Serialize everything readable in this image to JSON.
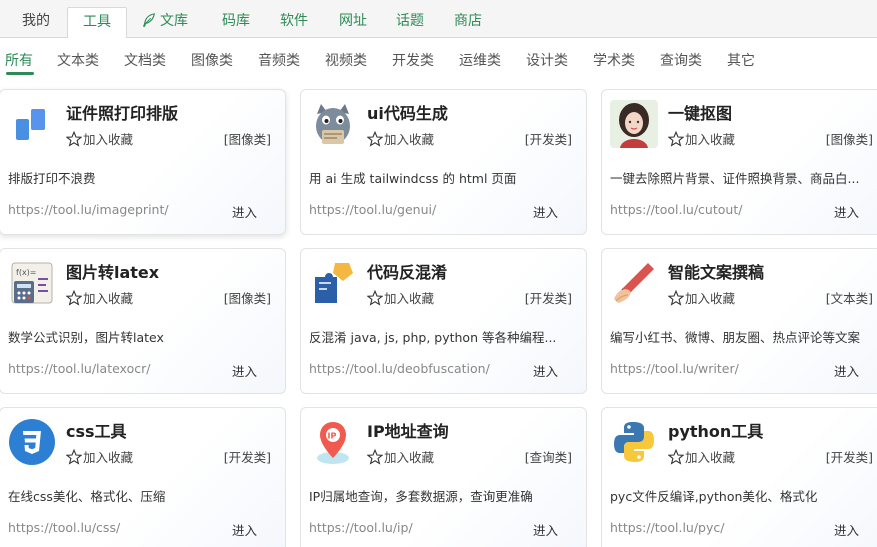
{
  "top_nav": [
    "我的",
    "工具",
    "文库",
    "码库",
    "软件",
    "网址",
    "话题",
    "商店"
  ],
  "categories": [
    "所有",
    "文本类",
    "文档类",
    "图像类",
    "音频类",
    "视频类",
    "开发类",
    "运维类",
    "设计类",
    "学术类",
    "查询类",
    "其它"
  ],
  "fav_label": "加入收藏",
  "enter_label": "进入",
  "tools": [
    {
      "title": "证件照打印排版",
      "tag": "[图像类]",
      "desc": "排版打印不浪费",
      "url": "https://tool.lu/imageprint/"
    },
    {
      "title": "ui代码生成",
      "tag": "[开发类]",
      "desc": "用 ai 生成 tailwindcss 的 html 页面",
      "url": "https://tool.lu/genui/"
    },
    {
      "title": "一键抠图",
      "tag": "[图像类]",
      "desc": "一键去除照片背景、证件照换背景、商品白...",
      "url": "https://tool.lu/cutout/"
    },
    {
      "title": "图片转latex",
      "tag": "[图像类]",
      "desc": "数学公式识别，图片转latex",
      "url": "https://tool.lu/latexocr/"
    },
    {
      "title": "代码反混淆",
      "tag": "[开发类]",
      "desc": "反混淆 java, js, php, python 等各种编程...",
      "url": "https://tool.lu/deobfuscation/"
    },
    {
      "title": "智能文案撰稿",
      "tag": "[文本类]",
      "desc": "编写小红书、微博、朋友圈、热点评论等文案",
      "url": "https://tool.lu/writer/"
    },
    {
      "title": "css工具",
      "tag": "[开发类]",
      "desc": "在线css美化、格式化、压缩",
      "url": "https://tool.lu/css/"
    },
    {
      "title": "IP地址查询",
      "tag": "[查询类]",
      "desc": "IP归属地查询，多套数据源，查询更准确",
      "url": "https://tool.lu/ip/"
    },
    {
      "title": "python工具",
      "tag": "[开发类]",
      "desc": "pyc文件反编译,python美化、格式化",
      "url": "https://tool.lu/pyc/"
    }
  ],
  "colors": {
    "accent": "#2e8b57",
    "tab_bar_bg": "#f5f5f5",
    "card_border": "#e3e3e3"
  }
}
